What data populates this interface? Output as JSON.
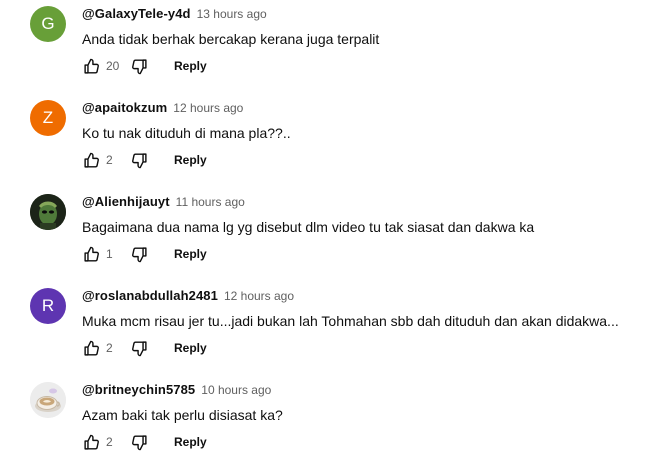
{
  "colors": {
    "avatar_g": "#689f38",
    "avatar_z": "#ef6c00",
    "avatar_r": "#5e35b1",
    "text": "#0f0f0f",
    "meta": "#606060"
  },
  "comments": [
    {
      "avatar_letter": "G",
      "author": "@GalaxyTele-y4d",
      "time": "13 hours ago",
      "text": "Anda tidak berhak bercakap kerana juga terpalit",
      "likes": "20",
      "reply_label": "Reply"
    },
    {
      "avatar_letter": "Z",
      "author": "@apaitokzum",
      "time": "12 hours ago",
      "text": "Ko tu nak dituduh di mana pla??..",
      "likes": "2",
      "reply_label": "Reply"
    },
    {
      "avatar_letter": "",
      "author": "@Alienhijauyt",
      "time": "11 hours ago",
      "text": "Bagaimana dua nama lg yg disebut dlm video tu tak siasat dan dakwa ka",
      "likes": "1",
      "reply_label": "Reply"
    },
    {
      "avatar_letter": "R",
      "author": "@roslanabdullah2481",
      "time": "12 hours ago",
      "text": "Muka mcm risau jer tu...jadi bukan lah Tohmahan sbb dah dituduh dan akan didakwa...",
      "likes": "2",
      "reply_label": "Reply"
    },
    {
      "avatar_letter": "",
      "author": "@britneychin5785",
      "time": "10 hours ago",
      "text": "Azam baki tak perlu disiasat ka?",
      "likes": "2",
      "reply_label": "Reply"
    }
  ]
}
